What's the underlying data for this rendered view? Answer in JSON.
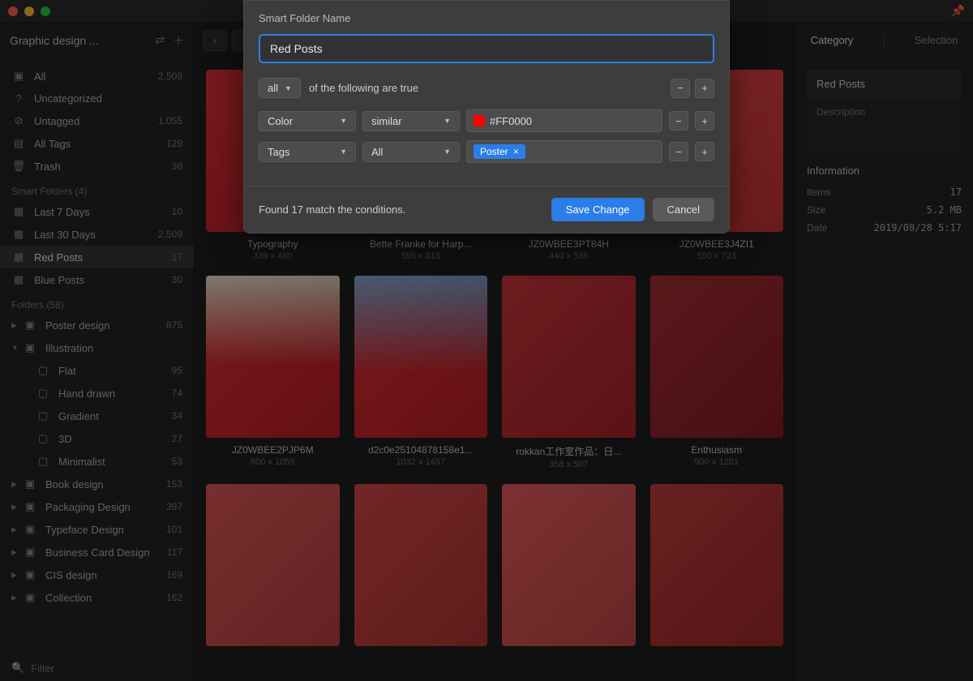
{
  "sidebar": {
    "library_name": "Graphic design ...",
    "fixed": [
      {
        "icon": "all",
        "label": "All",
        "count": "2,508"
      },
      {
        "icon": "uncat",
        "label": "Uncategorized",
        "count": ""
      },
      {
        "icon": "untag",
        "label": "Untagged",
        "count": "1,055"
      },
      {
        "icon": "tags",
        "label": "All Tags",
        "count": "129"
      },
      {
        "icon": "trash",
        "label": "Trash",
        "count": "38"
      }
    ],
    "smart_section": "Smart Folders (4)",
    "smart": [
      {
        "label": "Last 7 Days",
        "count": "10"
      },
      {
        "label": "Last 30 Days",
        "count": "2,509"
      },
      {
        "label": "Red Posts",
        "count": "17",
        "active": true
      },
      {
        "label": "Blue Posts",
        "count": "30"
      }
    ],
    "folders_section": "Folders (58)",
    "folders": [
      {
        "label": "Poster design",
        "count": "875",
        "expanded": false
      },
      {
        "label": "Illustration",
        "count": "",
        "expanded": true,
        "children": [
          {
            "label": "Flat",
            "count": "95"
          },
          {
            "label": "Hand drawn",
            "count": "74"
          },
          {
            "label": "Gradient",
            "count": "34"
          },
          {
            "label": "3D",
            "count": "27"
          },
          {
            "label": "Minimalist",
            "count": "53"
          }
        ]
      },
      {
        "label": "Book design",
        "count": "153"
      },
      {
        "label": "Packaging Design",
        "count": "397"
      },
      {
        "label": "Typeface Design",
        "count": "101"
      },
      {
        "label": "Business Card Design",
        "count": "117"
      },
      {
        "label": "CIS design",
        "count": "169"
      },
      {
        "label": "Collection",
        "count": "162"
      }
    ],
    "filter_placeholder": "Filter"
  },
  "gallery": {
    "items": [
      {
        "title": "Typography",
        "dims": "339 x 480",
        "v": ""
      },
      {
        "title": "Bette Franke for Harp...",
        "dims": "595 x 818",
        "v": "v2"
      },
      {
        "title": "JZ0WBEE3PT84H",
        "dims": "440 x 536",
        "v": "v3"
      },
      {
        "title": "JZ0WBEE3J4ZI1",
        "dims": "550 x 723",
        "v": "v4"
      },
      {
        "title": "JZ0WBEE2PJP6M",
        "dims": "800 x 1055",
        "v": "v5"
      },
      {
        "title": "d2c0e25104878158e1...",
        "dims": "1032 x 1457",
        "v": "v6"
      },
      {
        "title": "rokkan工作室作品：日...",
        "dims": "358 x 507",
        "v": "v7"
      },
      {
        "title": "Enthusiasm",
        "dims": "900 x 1281",
        "v": "v8"
      },
      {
        "title": "",
        "dims": "",
        "v": "v9"
      },
      {
        "title": "",
        "dims": "",
        "v": "v10"
      },
      {
        "title": "",
        "dims": "",
        "v": "v11"
      },
      {
        "title": "",
        "dims": "",
        "v": "v12"
      }
    ]
  },
  "rightbar": {
    "tab_category": "Category",
    "tab_selection": "Selection",
    "name": "Red Posts",
    "description_placeholder": "Description",
    "info_title": "Information",
    "rows": [
      {
        "key": "Items",
        "val": "17"
      },
      {
        "key": "Size",
        "val": "5.2 MB"
      },
      {
        "key": "Date",
        "val": "2019/08/28 5:17"
      }
    ]
  },
  "modal": {
    "heading": "Smart Folder Name",
    "name_value": "Red Posts",
    "match_all_label": "all",
    "match_text": "of the following are true",
    "rules": [
      {
        "field": "Color",
        "op": "similar",
        "value_text": "#FF0000",
        "value_kind": "color"
      },
      {
        "field": "Tags",
        "op": "All",
        "value_text": "Poster",
        "value_kind": "tag"
      }
    ],
    "found_text": "Found 17 match the conditions.",
    "save_label": "Save Change",
    "cancel_label": "Cancel"
  }
}
